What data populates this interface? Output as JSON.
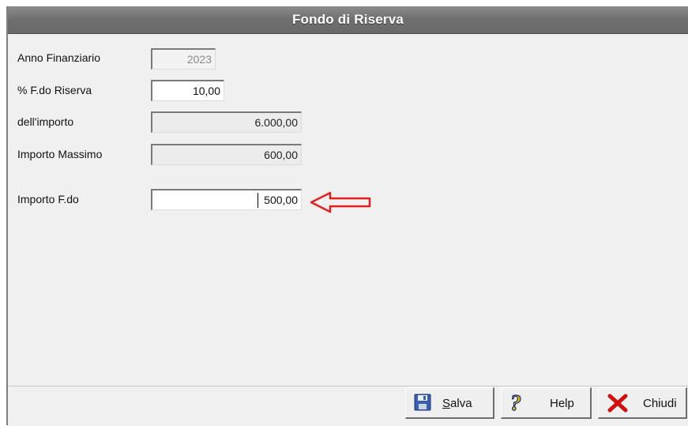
{
  "window": {
    "title": "Fondo di Riserva"
  },
  "fields": [
    {
      "label": "Anno Finanziario",
      "value": "2023",
      "state": "disabled"
    },
    {
      "label": "% F.do Riserva",
      "value": "10,00",
      "state": "editable"
    },
    {
      "label": "dell'importo",
      "value": "6.000,00",
      "state": "readonly"
    },
    {
      "label": "Importo Massimo",
      "value": "600,00",
      "state": "readonly"
    },
    {
      "label": "Importo F.do",
      "value": "500,00",
      "state": "editable-focused"
    }
  ],
  "annotation": {
    "arrow_color": "#e02020",
    "icon": "red-outline-arrow-left"
  },
  "buttons": {
    "save": {
      "label_first": "S",
      "label_rest": "alva",
      "icon": "floppy-disk-icon"
    },
    "help": {
      "label": "Help",
      "icon": "question-mark-icon"
    },
    "close": {
      "label": "Chiudi",
      "icon": "red-x-icon"
    }
  }
}
